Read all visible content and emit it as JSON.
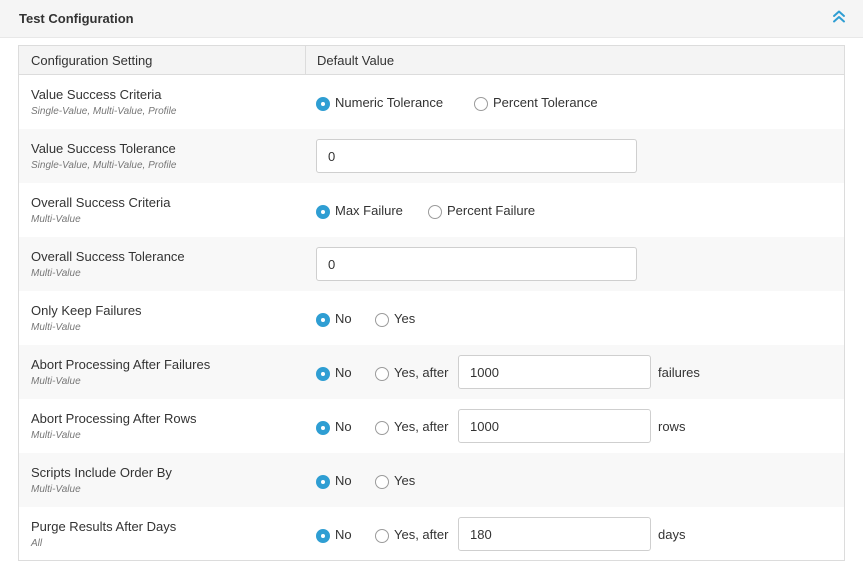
{
  "panel": {
    "title": "Test Configuration"
  },
  "table": {
    "headers": {
      "setting": "Configuration Setting",
      "value": "Default Value"
    },
    "rows": [
      {
        "name": "Value Success Criteria",
        "scope": "Single-Value, Multi-Value, Profile",
        "opt1": "Numeric Tolerance",
        "opt2": "Percent Tolerance",
        "selected": "opt1"
      },
      {
        "name": "Value Success Tolerance",
        "scope": "Single-Value, Multi-Value, Profile",
        "input_value": "0"
      },
      {
        "name": "Overall Success Criteria",
        "scope": "Multi-Value",
        "opt1": "Max Failure",
        "opt2": "Percent Failure",
        "selected": "opt1"
      },
      {
        "name": "Overall Success Tolerance",
        "scope": "Multi-Value",
        "input_value": "0"
      },
      {
        "name": "Only Keep Failures",
        "scope": "Multi-Value",
        "opt1": "No",
        "opt2": "Yes",
        "selected": "opt1"
      },
      {
        "name": "Abort Processing After Failures",
        "scope": "Multi-Value",
        "opt1": "No",
        "opt2": "Yes, after",
        "selected": "opt1",
        "input_value": "1000",
        "suffix": "failures"
      },
      {
        "name": "Abort Processing After Rows",
        "scope": "Multi-Value",
        "opt1": "No",
        "opt2": "Yes, after",
        "selected": "opt1",
        "input_value": "1000",
        "suffix": "rows"
      },
      {
        "name": "Scripts Include Order By",
        "scope": "Multi-Value",
        "opt1": "No",
        "opt2": "Yes",
        "selected": "opt1"
      },
      {
        "name": "Purge Results After Days",
        "scope": "All",
        "opt1": "No",
        "opt2": "Yes, after",
        "selected": "opt1",
        "input_value": "180",
        "suffix": "days"
      }
    ]
  },
  "colors": {
    "accent": "#2f9ed3",
    "header_bg": "#f5f5f5",
    "row_alt": "#f8f8f8"
  },
  "icons": {
    "collapse": "chevron-double-up-icon"
  }
}
